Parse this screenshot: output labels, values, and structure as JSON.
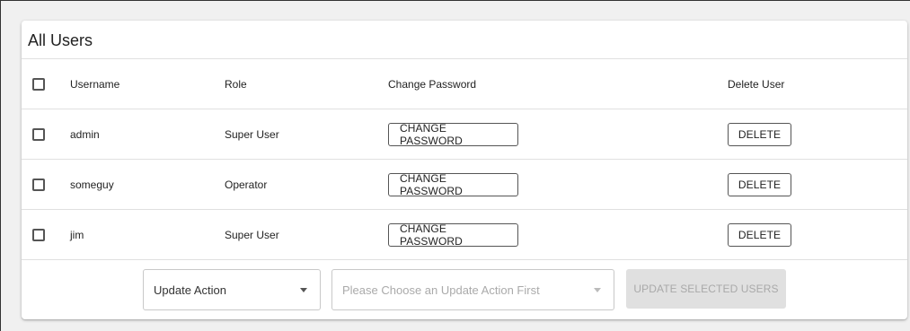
{
  "card": {
    "title": "All Users"
  },
  "table": {
    "headers": {
      "username": "Username",
      "role": "Role",
      "change_password": "Change Password",
      "delete_user": "Delete User"
    },
    "rows": [
      {
        "username": "admin",
        "role": "Super User",
        "change_password_label": "CHANGE PASSWORD",
        "delete_label": "DELETE",
        "checked": false
      },
      {
        "username": "someguy",
        "role": "Operator",
        "change_password_label": "CHANGE PASSWORD",
        "delete_label": "DELETE",
        "checked": false
      },
      {
        "username": "jim",
        "role": "Super User",
        "change_password_label": "CHANGE PASSWORD",
        "delete_label": "DELETE",
        "checked": false
      }
    ]
  },
  "footer": {
    "update_action_select": {
      "value": "Update Action"
    },
    "second_select": {
      "placeholder": "Please Choose an Update Action First"
    },
    "update_button_label": "UPDATE SELECTED USERS"
  }
}
